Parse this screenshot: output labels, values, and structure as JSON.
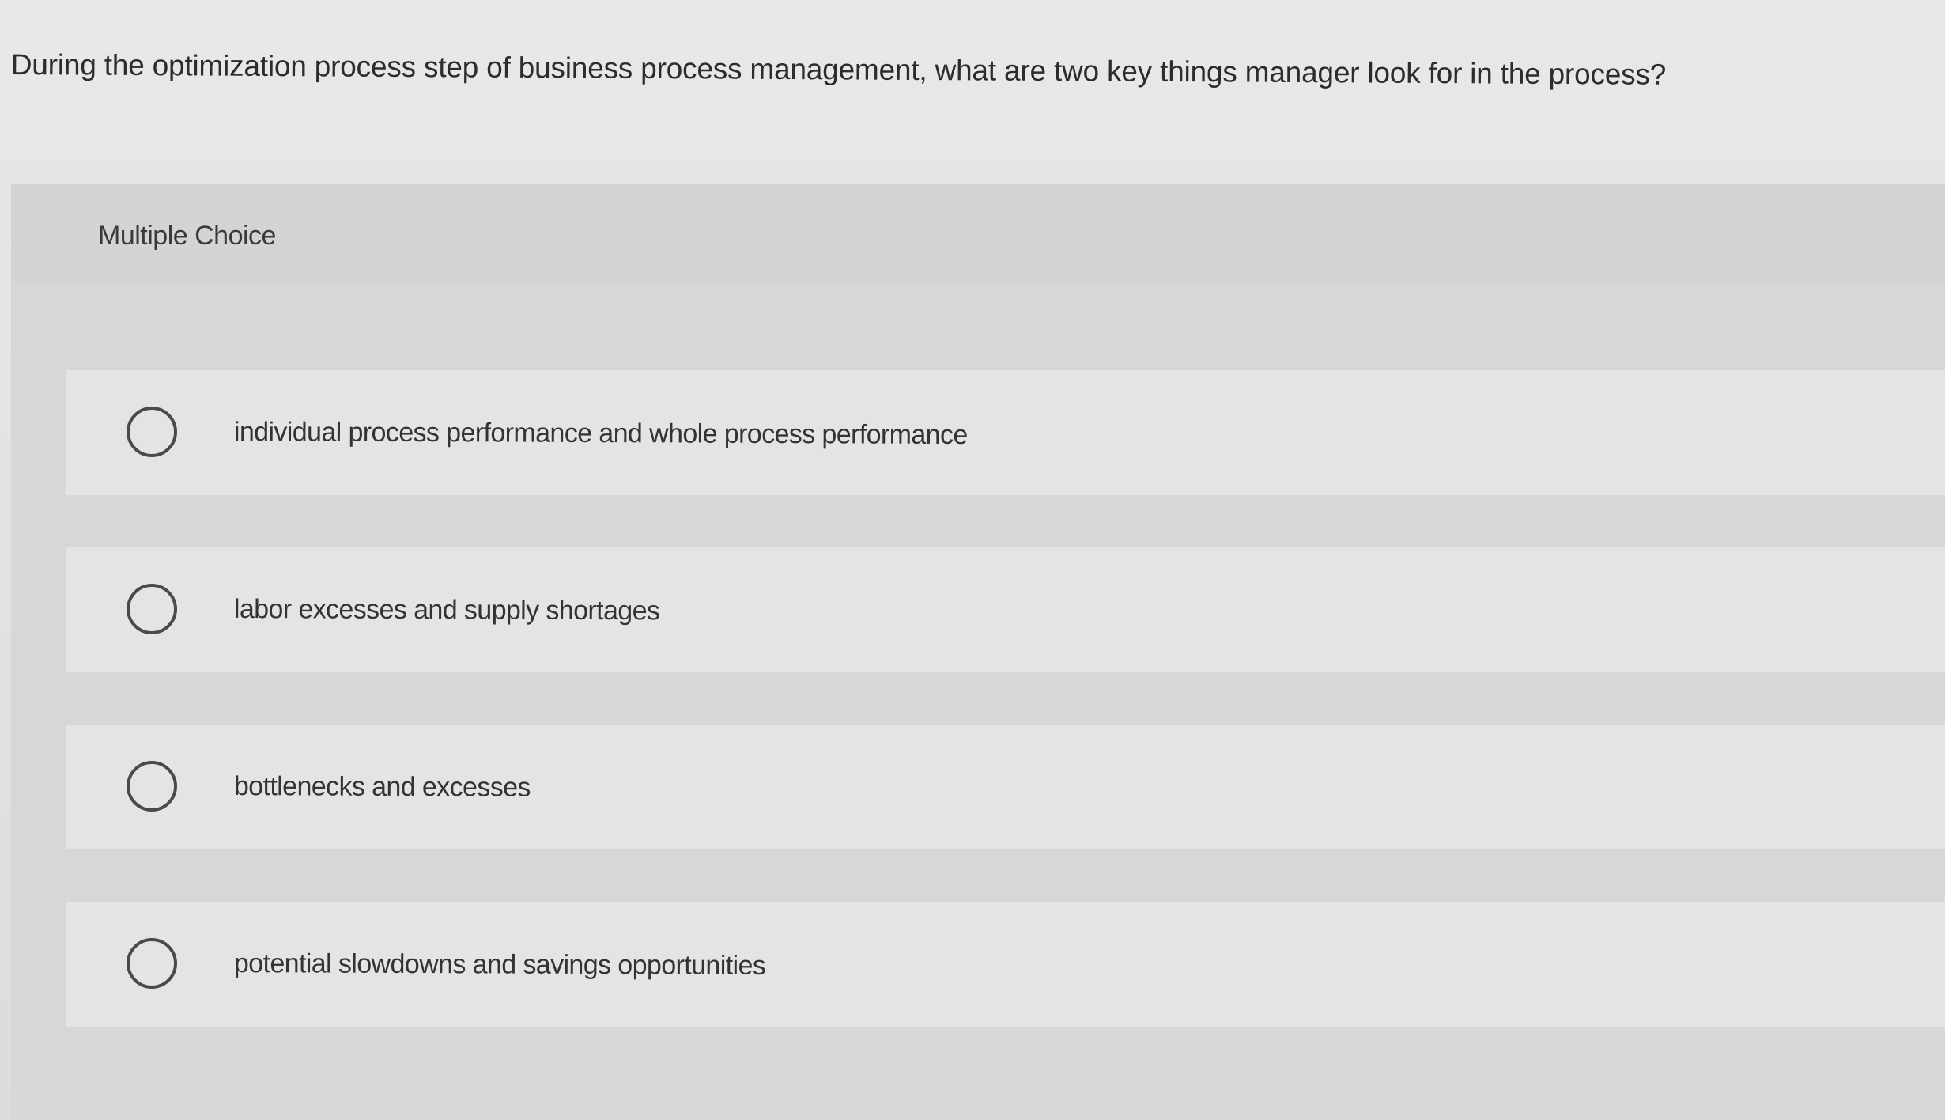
{
  "question": {
    "text": "During the optimization process step of business process management, what are two key things manager look for in the process?"
  },
  "answer_panel": {
    "type_label": "Multiple Choice",
    "options": [
      {
        "label": "individual process performance and whole process performance",
        "selected": false
      },
      {
        "label": "labor excesses and supply shortages",
        "selected": false
      },
      {
        "label": "bottlenecks and excesses",
        "selected": false
      },
      {
        "label": "potential slowdowns and savings opportunities",
        "selected": false
      }
    ]
  },
  "colors": {
    "background": "#e3e4e2",
    "panel": "#d7d8d6",
    "option_row": "#e4e5e3",
    "text": "#2c2c2c",
    "radio_border": "#4a4a4a"
  }
}
